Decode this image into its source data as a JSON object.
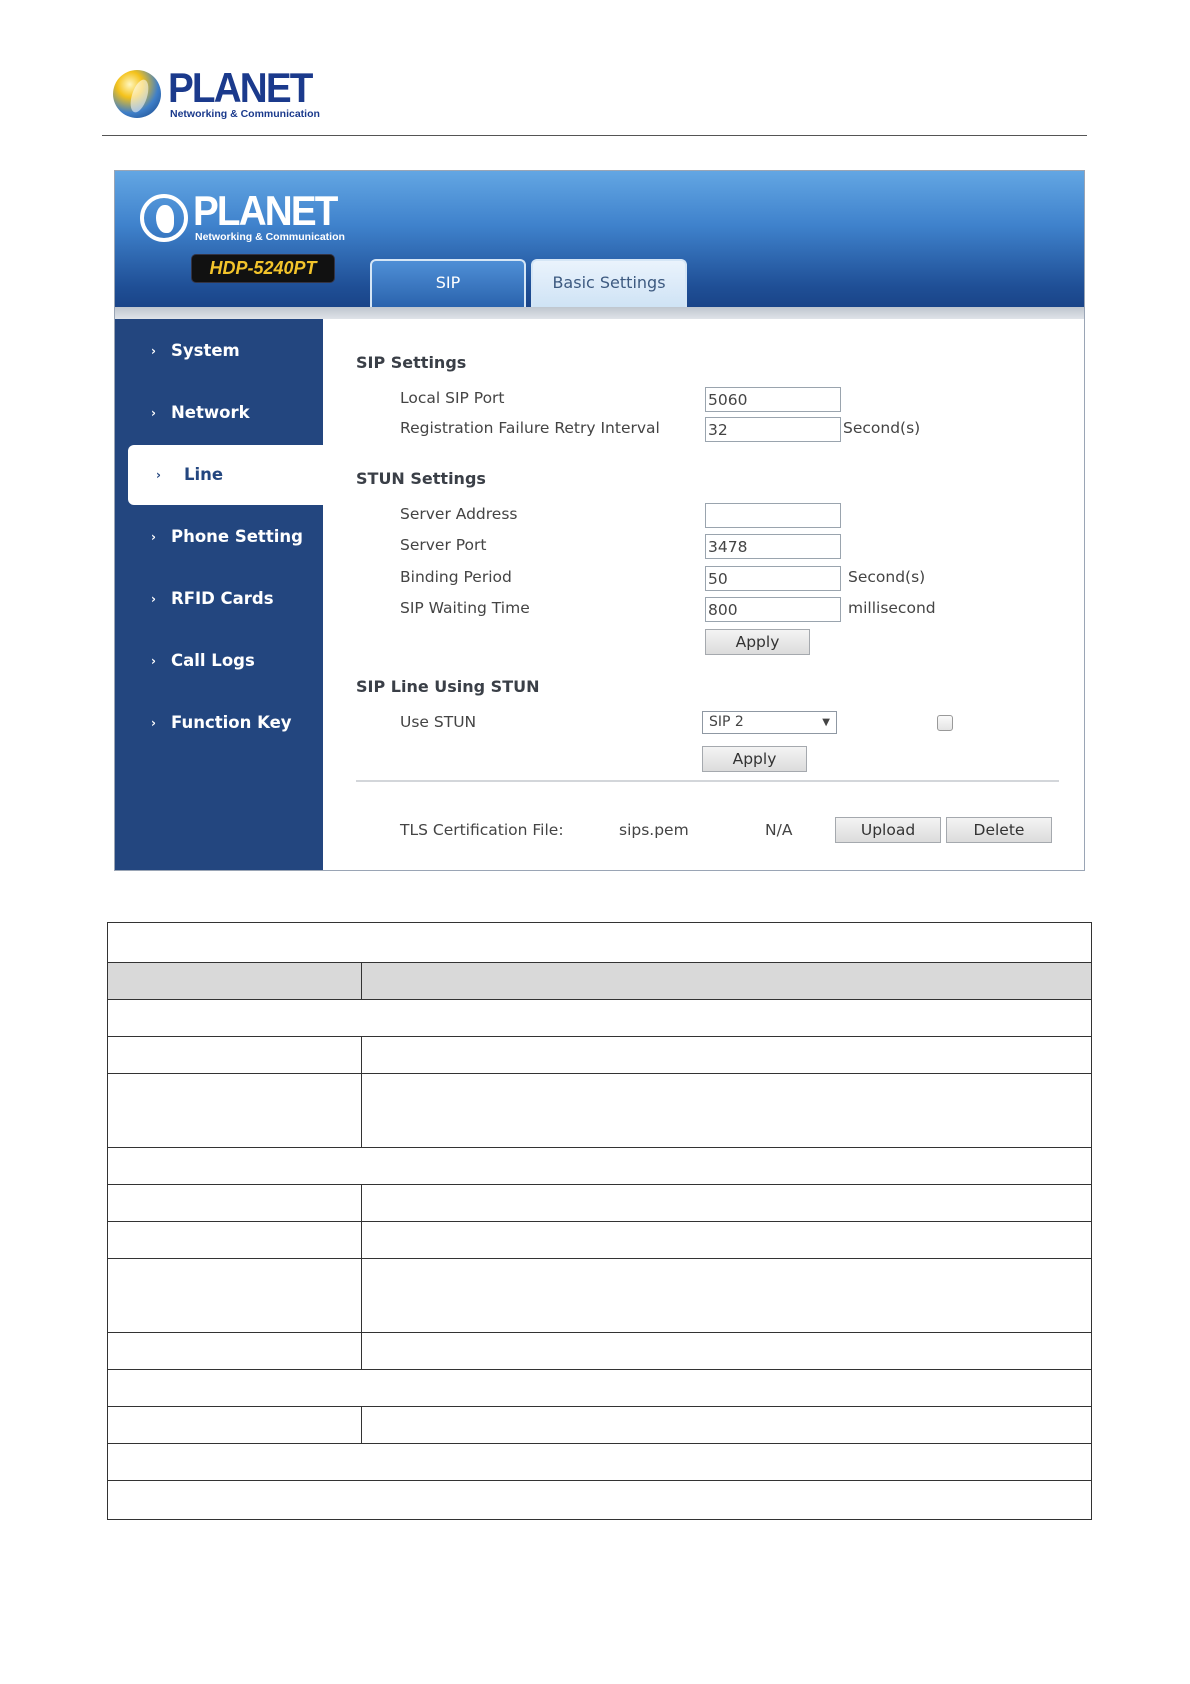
{
  "document_header": {
    "brand": "PLANET",
    "tagline": "Networking & Communication"
  },
  "ui": {
    "logo": {
      "brand": "PLANET",
      "tagline": "Networking & Communication"
    },
    "model": "HDP-5240PT",
    "tabs": [
      {
        "label": "SIP",
        "active": true
      },
      {
        "label": "Basic Settings",
        "active": false
      }
    ],
    "sidebar": [
      {
        "label": "System"
      },
      {
        "label": "Network"
      },
      {
        "label": "Line",
        "active": true
      },
      {
        "label": "Phone Setting"
      },
      {
        "label": "RFID Cards"
      },
      {
        "label": "Call Logs"
      },
      {
        "label": "Function Key"
      }
    ],
    "sip_settings": {
      "title": "SIP Settings",
      "local_port_label": "Local SIP Port",
      "local_port_value": "5060",
      "retry_label": "Registration Failure Retry Interval",
      "retry_value": "32",
      "retry_unit": "Second(s)"
    },
    "stun_settings": {
      "title": "STUN Settings",
      "server_address_label": "Server Address",
      "server_address_value": "",
      "server_port_label": "Server Port",
      "server_port_value": "3478",
      "binding_label": "Binding Period",
      "binding_value": "50",
      "binding_unit": "Second(s)",
      "waiting_label": "SIP Waiting Time",
      "waiting_value": "800",
      "waiting_unit": "millisecond",
      "apply_label": "Apply"
    },
    "sip_line_stun": {
      "title": "SIP Line Using STUN",
      "use_stun_label": "Use STUN",
      "line_selected": "SIP 2",
      "checked": false,
      "apply_label": "Apply"
    },
    "tls": {
      "label": "TLS Certification File:",
      "file": "sips.pem",
      "status": "N/A",
      "upload_label": "Upload",
      "delete_label": "Delete"
    }
  }
}
